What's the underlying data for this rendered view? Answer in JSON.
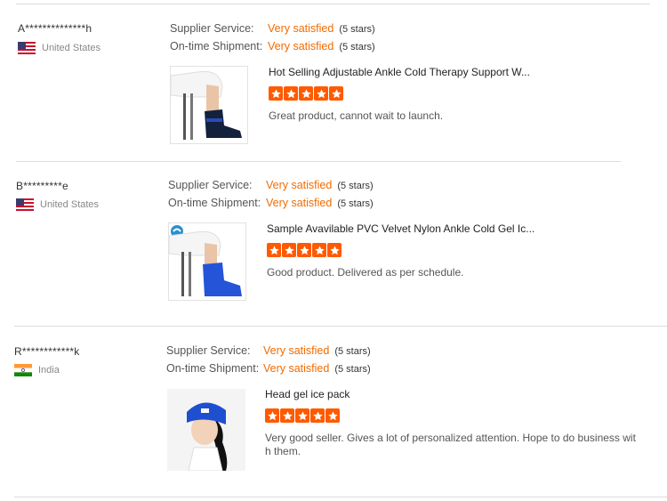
{
  "reviews": [
    {
      "reviewer": "A**************h",
      "country": "United States",
      "supplier_label": "Supplier Service:",
      "supplier_value": "Very satisfied",
      "supplier_stars": "(5 stars)",
      "shipment_label": "On-time Shipment:",
      "shipment_value": "Very satisfied",
      "shipment_stars": "(5 stars)",
      "product_title": "Hot Selling Adjustable Ankle Cold Therapy Support W...",
      "rating": 5,
      "comment": "Great product, cannot wait to launch."
    },
    {
      "reviewer": "B*********e",
      "country": "United States",
      "supplier_label": "Supplier Service:",
      "supplier_value": "Very satisfied",
      "supplier_stars": "(5 stars)",
      "shipment_label": "On-time Shipment:",
      "shipment_value": "Very satisfied",
      "shipment_stars": "(5 stars)",
      "product_title": "Sample Avavilable PVC Velvet Nylon Ankle Cold Gel Ic...",
      "rating": 5,
      "comment": "Good product. Delivered as per schedule."
    },
    {
      "reviewer": "R************k",
      "country": "India",
      "supplier_label": "Supplier Service:",
      "supplier_value": "Very satisfied",
      "supplier_stars": "(5 stars)",
      "shipment_label": "On-time Shipment:",
      "shipment_value": "Very satisfied",
      "shipment_stars": "(5 stars)",
      "product_title": "Head gel ice pack",
      "rating": 5,
      "comment_line1": "Very good seller. Gives a lot of personalized attention. Hope to do business wit",
      "comment_line2": "h them."
    }
  ],
  "colors": {
    "accent": "#f26b00",
    "star": "#ff5a00",
    "divider": "#dcdcdc"
  },
  "icons": [
    "us-flag-icon",
    "india-flag-icon",
    "star-icon"
  ]
}
